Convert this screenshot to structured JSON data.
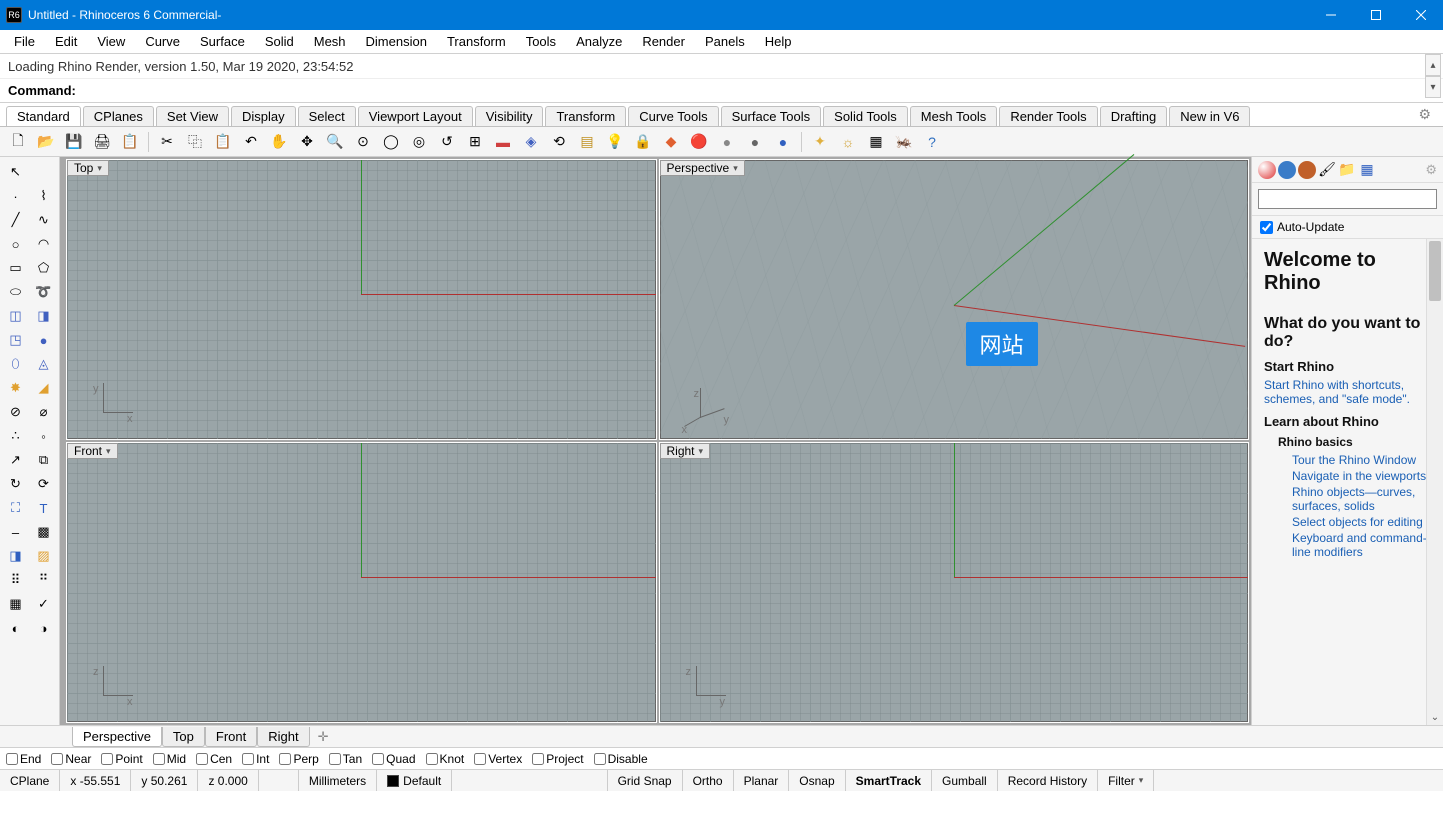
{
  "title": "Untitled - Rhinoceros 6 Commercial-",
  "menu": [
    "File",
    "Edit",
    "View",
    "Curve",
    "Surface",
    "Solid",
    "Mesh",
    "Dimension",
    "Transform",
    "Tools",
    "Analyze",
    "Render",
    "Panels",
    "Help"
  ],
  "cmd_history": "Loading Rhino Render, version 1.50, Mar 19 2020, 23:54:52",
  "cmd_label": "Command:",
  "tabs": [
    "Standard",
    "CPlanes",
    "Set View",
    "Display",
    "Select",
    "Viewport Layout",
    "Visibility",
    "Transform",
    "Curve Tools",
    "Surface Tools",
    "Solid Tools",
    "Mesh Tools",
    "Render Tools",
    "Drafting",
    "New in V6"
  ],
  "active_tab": 0,
  "viewports": {
    "tl": "Top",
    "tr": "Perspective",
    "bl": "Front",
    "br": "Right"
  },
  "vp_tabs": [
    "Perspective",
    "Top",
    "Front",
    "Right"
  ],
  "right_panel": {
    "auto_update": "Auto-Update",
    "welcome_title": "Welcome to Rhino",
    "q_title": "What do you want to do?",
    "start_heading": "Start Rhino",
    "start_link": "Start Rhino with shortcuts, schemes, and \"safe mode\".",
    "learn_heading": "Learn about Rhino",
    "basics_heading": "Rhino basics",
    "links": [
      "Tour the Rhino Window",
      "Navigate in the viewports",
      "Rhino objects—curves, surfaces, solids",
      "Select objects for editing",
      "Keyboard and command-line modifiers"
    ]
  },
  "osnap": [
    "End",
    "Near",
    "Point",
    "Mid",
    "Cen",
    "Int",
    "Perp",
    "Tan",
    "Quad",
    "Knot",
    "Vertex",
    "Project",
    "Disable"
  ],
  "status": {
    "cplane": "CPlane",
    "x": "x -55.551",
    "y": "y 50.261",
    "z": "z 0.000",
    "units": "Millimeters",
    "layer": "Default",
    "toggles": [
      "Grid Snap",
      "Ortho",
      "Planar",
      "Osnap",
      "SmartTrack",
      "Gumball",
      "Record History",
      "Filter"
    ],
    "bold_toggle": "SmartTrack"
  },
  "watermark": {
    "badge": "网站"
  }
}
